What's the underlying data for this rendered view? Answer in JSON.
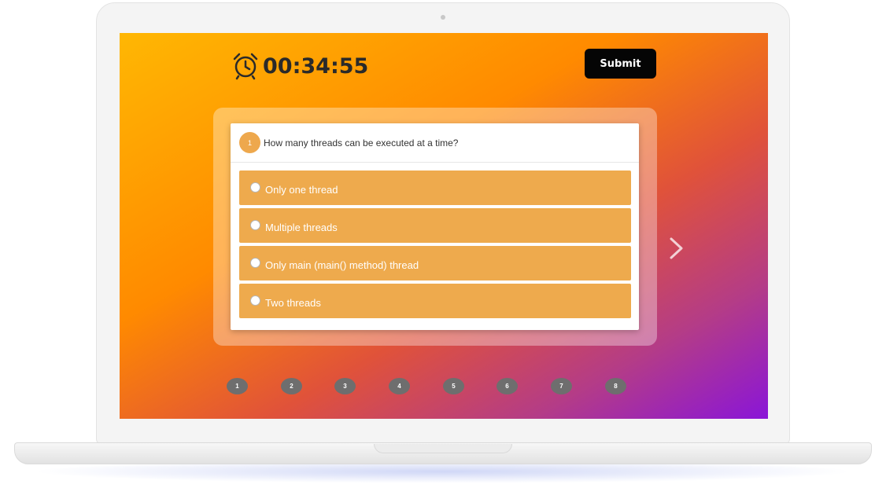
{
  "timer": {
    "value": "00:34:55",
    "icon": "alarm-clock-icon"
  },
  "submit_label": "Submit",
  "question": {
    "number": "1",
    "text": "How many threads can be executed at a time?",
    "options": [
      "Only one thread",
      "Multiple threads",
      "Only main (main() method) thread",
      "Two threads"
    ]
  },
  "pager": [
    "1",
    "2",
    "3",
    "4",
    "5",
    "6",
    "7",
    "8"
  ],
  "colors": {
    "option_bg": "#eeaa4d",
    "submit_bg": "#050505",
    "pager_dot": "#6e6e6e",
    "gradient_start": "#ffb703",
    "gradient_end": "#8a15d8"
  }
}
